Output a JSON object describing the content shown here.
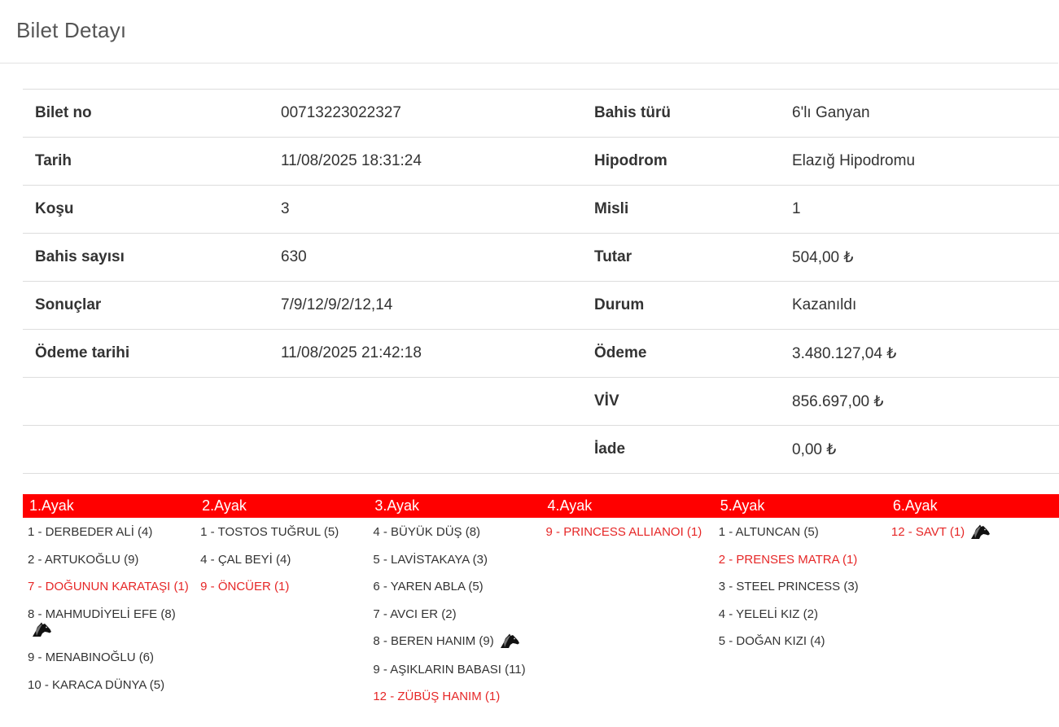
{
  "page": {
    "title": "Bilet Detayı"
  },
  "details": [
    {
      "l1": "Bilet no",
      "v1": "00713223022327",
      "l2": "Bahis türü",
      "v2": "6'lı Ganyan"
    },
    {
      "l1": "Tarih",
      "v1": "11/08/2025 18:31:24",
      "l2": "Hipodrom",
      "v2": "Elazığ Hipodromu"
    },
    {
      "l1": "Koşu",
      "v1": "3",
      "l2": "Misli",
      "v2": "1"
    },
    {
      "l1": "Bahis sayısı",
      "v1": "630",
      "l2": "Tutar",
      "v2": "504,00 ₺"
    },
    {
      "l1": "Sonuçlar",
      "v1": "7/9/12/9/2/12,14",
      "l2": "Durum",
      "v2": "Kazanıldı"
    },
    {
      "l1": "Ödeme tarihi",
      "v1": "11/08/2025 21:42:18",
      "l2": "Ödeme",
      "v2": "3.480.127,04 ₺"
    },
    {
      "l1": "",
      "v1": "",
      "l2": "VİV",
      "v2": "856.697,00 ₺"
    },
    {
      "l1": "",
      "v1": "",
      "l2": "İade",
      "v2": "0,00 ₺"
    }
  ],
  "colors": {
    "accent": "#ff0000",
    "winner": "#e62727",
    "text": "#333333"
  },
  "legs": [
    {
      "title": "1.Ayak",
      "horses": [
        {
          "label": "1 - DERBEDER ALİ (4)",
          "winner": false
        },
        {
          "label": "2 - ARTUKOĞLU (9)",
          "winner": false
        },
        {
          "label": "7 - DOĞUNUN KARATAŞI (1)",
          "winner": true
        },
        {
          "label": "8 - MAHMUDİYELİ EFE (8)",
          "winner": false,
          "icon": "horse-head-icon"
        },
        {
          "label": "9 - MENABINOĞLU (6)",
          "winner": false
        },
        {
          "label": "10 - KARACA DÜNYA (5)",
          "winner": false
        }
      ]
    },
    {
      "title": "2.Ayak",
      "horses": [
        {
          "label": "1 - TOSTOS TUĞRUL (5)",
          "winner": false
        },
        {
          "label": "4 - ÇAL BEYİ (4)",
          "winner": false
        },
        {
          "label": "9 - ÖNCÜER (1)",
          "winner": true
        }
      ]
    },
    {
      "title": "3.Ayak",
      "horses": [
        {
          "label": "4 - BÜYÜK DÜŞ (8)",
          "winner": false
        },
        {
          "label": "5 - LAVİSTAKAYA (3)",
          "winner": false
        },
        {
          "label": "6 - YAREN ABLA (5)",
          "winner": false
        },
        {
          "label": "7 - AVCI ER (2)",
          "winner": false
        },
        {
          "label": "8 - BEREN HANIM (9)",
          "winner": false,
          "icon": "horse-head-icon"
        },
        {
          "label": "9 - AŞIKLARIN BABASI (11)",
          "winner": false
        },
        {
          "label": "12 - ZÜBÜŞ HANIM (1)",
          "winner": true
        }
      ]
    },
    {
      "title": "4.Ayak",
      "horses": [
        {
          "label": "9 - PRINCESS ALLIANOI (1)",
          "winner": true
        }
      ]
    },
    {
      "title": "5.Ayak",
      "horses": [
        {
          "label": "1 - ALTUNCAN (5)",
          "winner": false
        },
        {
          "label": "2 - PRENSES MATRA (1)",
          "winner": true
        },
        {
          "label": "3 - STEEL PRINCESS (3)",
          "winner": false
        },
        {
          "label": "4 - YELELİ KIZ (2)",
          "winner": false
        },
        {
          "label": "5 - DOĞAN KIZI (4)",
          "winner": false
        }
      ]
    },
    {
      "title": "6.Ayak",
      "horses": [
        {
          "label": "12 - SAVT (1)",
          "winner": true,
          "icon": "horse-head-icon"
        }
      ]
    }
  ]
}
